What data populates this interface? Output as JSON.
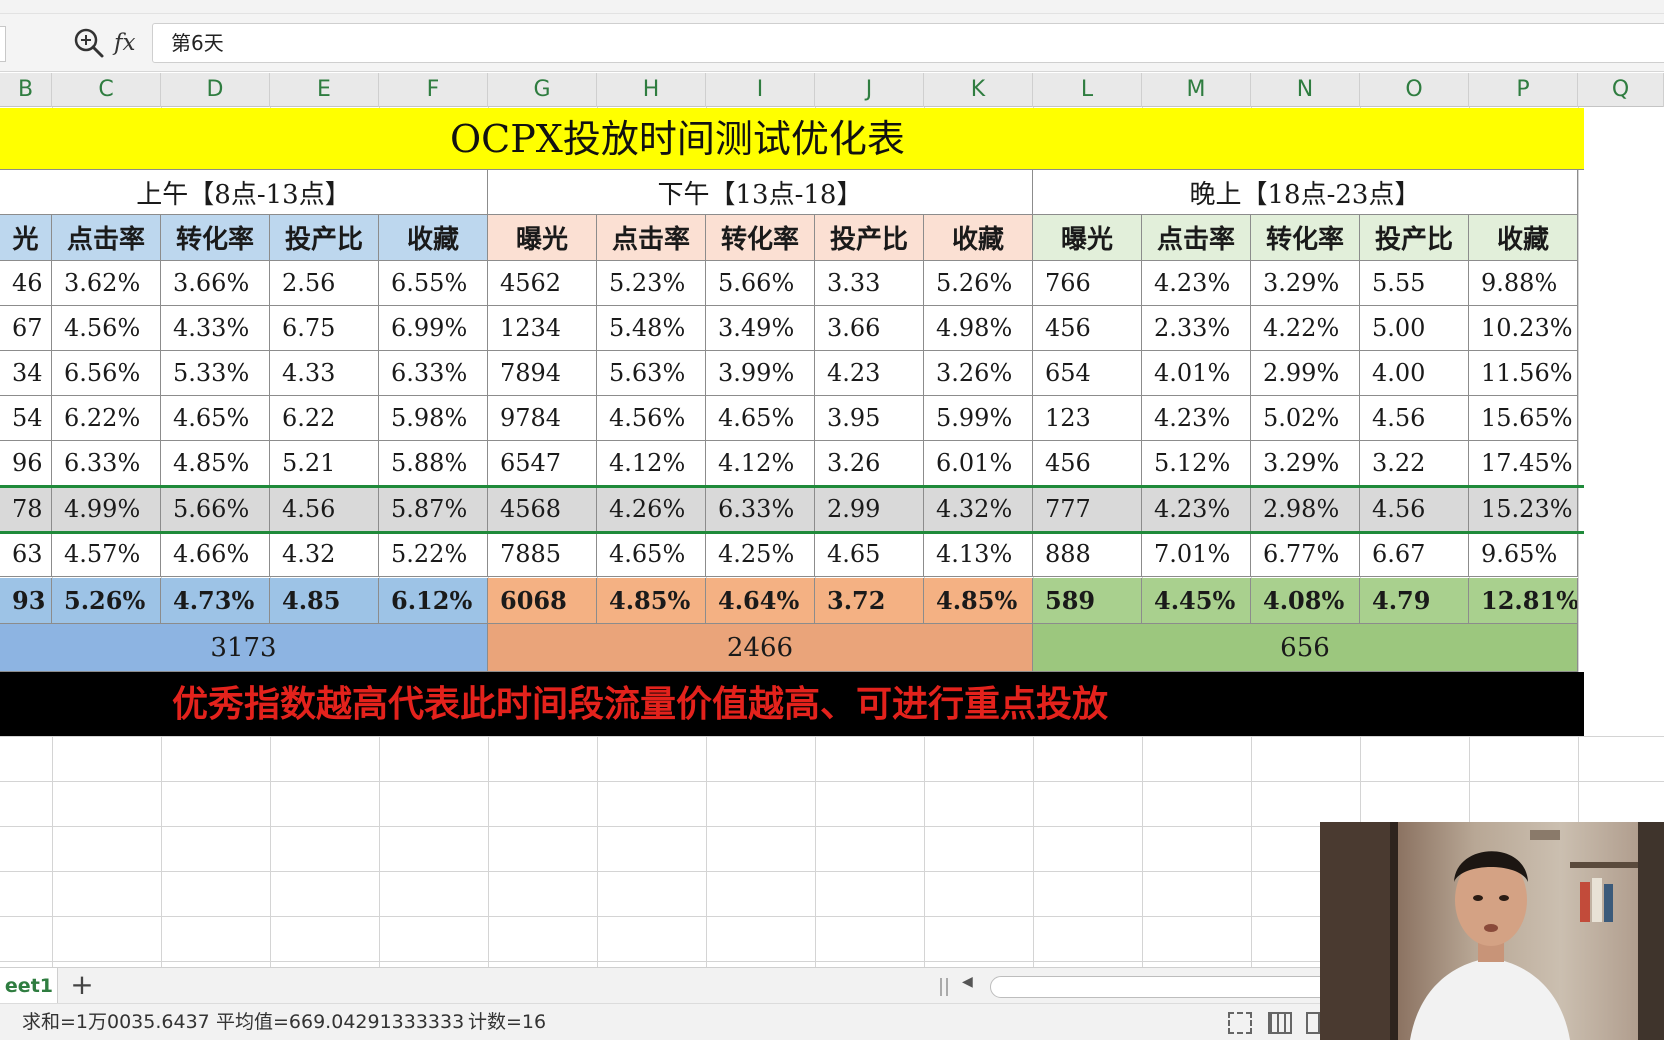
{
  "formula_bar": {
    "fx_label": "fx",
    "value": "第6天"
  },
  "column_headers": [
    "B",
    "C",
    "D",
    "E",
    "F",
    "G",
    "H",
    "I",
    "J",
    "K",
    "L",
    "M",
    "N",
    "O",
    "P",
    "Q"
  ],
  "title": "OCPX投放时间测试优化表",
  "sections": [
    {
      "label": "上午【8点-13点】",
      "color": "#bdd7ee",
      "avg_color": "#9dc3e6",
      "total": "3173"
    },
    {
      "label": "下午【13点-18】",
      "color": "#fbe0d3",
      "avg_color": "#f4b183",
      "total": "2466"
    },
    {
      "label": "晚上【18点-23点】",
      "color": "#e2efda",
      "avg_color": "#a9d08e",
      "total": "656"
    }
  ],
  "metric_headers": [
    [
      "光",
      "点击率",
      "转化率",
      "投产比",
      "收藏"
    ],
    [
      "曝光",
      "点击率",
      "转化率",
      "投产比",
      "收藏"
    ],
    [
      "曝光",
      "点击率",
      "转化率",
      "投产比",
      "收藏"
    ]
  ],
  "rows": [
    [
      "46",
      "3.62%",
      "3.66%",
      "2.56",
      "6.55%",
      "4562",
      "5.23%",
      "5.66%",
      "3.33",
      "5.26%",
      "766",
      "4.23%",
      "3.29%",
      "5.55",
      "9.88%"
    ],
    [
      "67",
      "4.56%",
      "4.33%",
      "6.75",
      "6.99%",
      "1234",
      "5.48%",
      "3.49%",
      "3.66",
      "4.98%",
      "456",
      "2.33%",
      "4.22%",
      "5.00",
      "10.23%"
    ],
    [
      "34",
      "6.56%",
      "5.33%",
      "4.33",
      "6.33%",
      "7894",
      "5.63%",
      "3.99%",
      "4.23",
      "3.26%",
      "654",
      "4.01%",
      "2.99%",
      "4.00",
      "11.56%"
    ],
    [
      "54",
      "6.22%",
      "4.65%",
      "6.22",
      "5.98%",
      "9784",
      "4.56%",
      "4.65%",
      "3.95",
      "5.99%",
      "123",
      "4.23%",
      "5.02%",
      "4.56",
      "15.65%"
    ],
    [
      "96",
      "6.33%",
      "4.85%",
      "5.21",
      "5.88%",
      "6547",
      "4.12%",
      "4.12%",
      "3.26",
      "6.01%",
      "456",
      "5.12%",
      "3.29%",
      "3.22",
      "17.45%"
    ],
    [
      "78",
      "4.99%",
      "5.66%",
      "4.56",
      "5.87%",
      "4568",
      "4.26%",
      "6.33%",
      "2.99",
      "4.32%",
      "777",
      "4.23%",
      "2.98%",
      "4.56",
      "15.23%"
    ],
    [
      "63",
      "4.57%",
      "4.66%",
      "4.32",
      "5.22%",
      "7885",
      "4.65%",
      "4.25%",
      "4.65",
      "4.13%",
      "888",
      "7.01%",
      "6.77%",
      "6.67",
      "9.65%"
    ]
  ],
  "average_row": [
    "93",
    "5.26%",
    "4.73%",
    "4.85",
    "6.12%",
    "6068",
    "4.85%",
    "4.64%",
    "3.72",
    "4.85%",
    "589",
    "4.45%",
    "4.08%",
    "4.79",
    "12.81%"
  ],
  "banner": "优秀指数越高代表此时间段流量价值越高、可进行重点投放",
  "sheet_tab": "eet1",
  "add_sheet": "+",
  "status": {
    "sum": "求和=1万0035.6437",
    "average": "平均值=669.04291333333",
    "count": "计数=16"
  }
}
